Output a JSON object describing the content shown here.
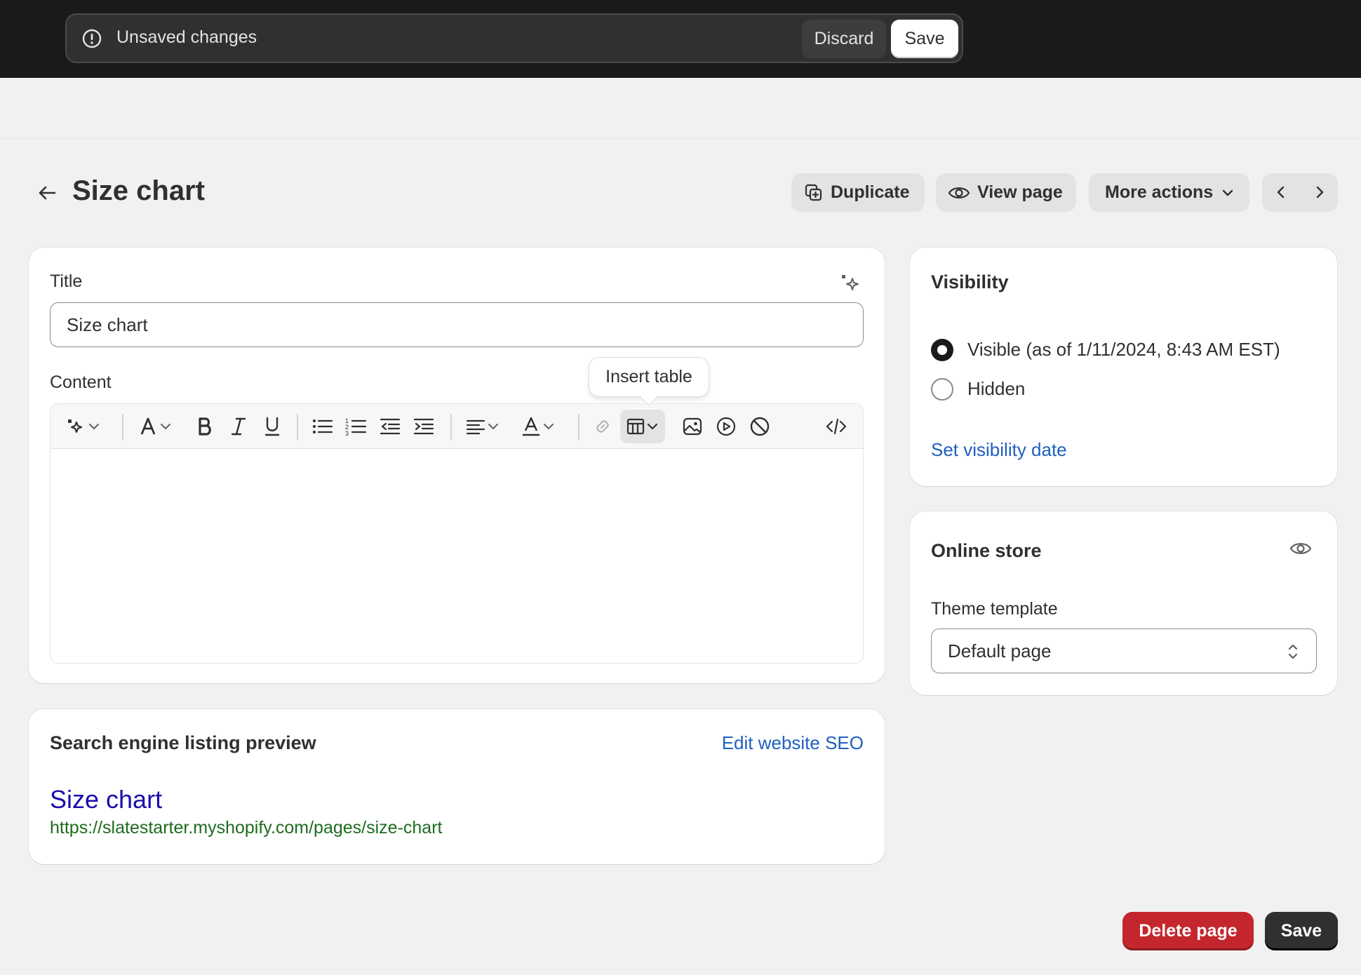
{
  "save_bar": {
    "message": "Unsaved changes",
    "discard_label": "Discard",
    "save_label": "Save"
  },
  "header": {
    "title": "Size chart",
    "actions": {
      "duplicate": "Duplicate",
      "view_page": "View page",
      "more_actions": "More actions"
    }
  },
  "main_card": {
    "title_label": "Title",
    "title_value": "Size chart",
    "content_label": "Content",
    "toolbar_tooltip": "Insert table",
    "toolbar_icons": [
      "magic-icon",
      "font-icon",
      "bold-icon",
      "italic-icon",
      "underline-icon",
      "bullet-list-icon",
      "numbered-list-icon",
      "outdent-icon",
      "indent-icon",
      "align-icon",
      "text-color-icon",
      "link-icon",
      "table-icon",
      "image-icon",
      "video-icon",
      "clear-format-icon",
      "code-icon"
    ]
  },
  "seo_card": {
    "heading": "Search engine listing preview",
    "edit_link": "Edit website SEO",
    "preview_title": "Size chart",
    "preview_url": "https://slatestarter.myshopify.com/pages/size-chart"
  },
  "visibility_card": {
    "heading": "Visibility",
    "options": [
      {
        "label": "Visible (as of 1/11/2024, 8:43 AM EST)",
        "selected": true
      },
      {
        "label": "Hidden",
        "selected": false
      }
    ],
    "set_date_link": "Set visibility date"
  },
  "store_card": {
    "heading": "Online store",
    "template_label": "Theme template",
    "template_value": "Default page"
  },
  "footer": {
    "delete_label": "Delete page",
    "save_label": "Save"
  },
  "colors": {
    "topbar": "#1a1a1a",
    "link": "#1f5fbf",
    "danger": "#c4262e",
    "seo_title": "#1a0dab",
    "seo_url": "#1e6b1e"
  }
}
